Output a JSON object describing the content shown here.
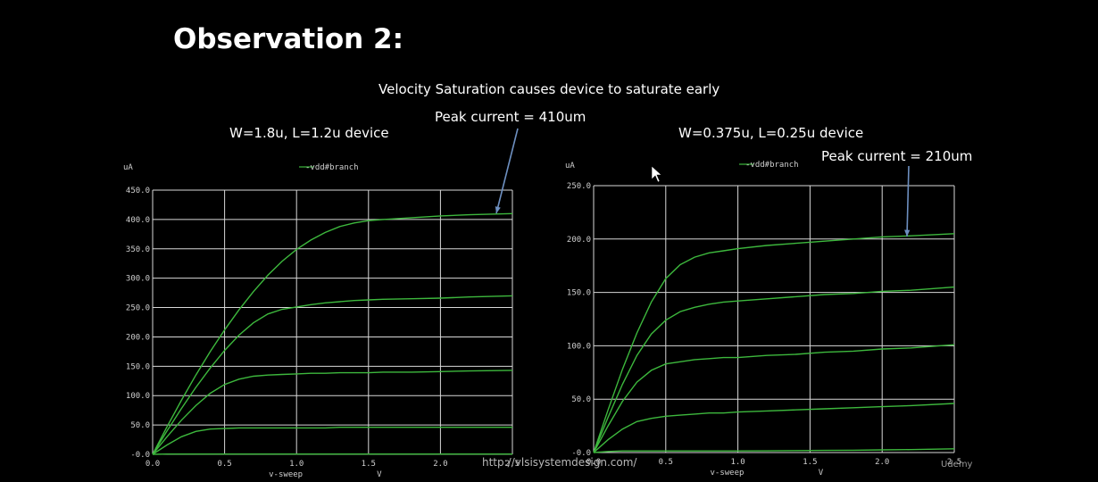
{
  "slide": {
    "title": "Observation 2:",
    "velocity_note": "Velocity Saturation causes device to saturate early",
    "watermark": "http://vlsisystemdesign.com/",
    "logo_text": "Udemy"
  },
  "colors": {
    "background": "#000000",
    "grid": "#d8d8d8",
    "curve": "#3db83d",
    "text": "#ffffff",
    "arrow": "#6d8fc0"
  },
  "chart_data": [
    {
      "type": "line",
      "device_label": "W=1.8u, L=1.2u device",
      "peak_annotation": "Peak current = 410um",
      "legend": "-vdd#branch",
      "legend_position": "top-center",
      "ylabel": "uA",
      "xlabel": "v-sweep",
      "xunit": "V",
      "xlim": [
        0,
        2.5
      ],
      "ylim": [
        0,
        450
      ],
      "xticks": [
        "0.0",
        "0.5",
        "1.0",
        "1.5",
        "2.0",
        "2.5"
      ],
      "yticks": [
        "-0.0",
        "50.0",
        "100.0",
        "150.0",
        "200.0",
        "250.0",
        "300.0",
        "350.0",
        "400.0",
        "450.0"
      ],
      "x": [
        0,
        0.1,
        0.2,
        0.3,
        0.4,
        0.5,
        0.6,
        0.7,
        0.8,
        0.9,
        1.0,
        1.1,
        1.2,
        1.3,
        1.4,
        1.5,
        1.6,
        1.8,
        2.0,
        2.2,
        2.5
      ],
      "series": [
        {
          "values": [
            0,
            47,
            92,
            135,
            175,
            212,
            246,
            277,
            305,
            329,
            349,
            365,
            378,
            388,
            394,
            398,
            400,
            403,
            406,
            408,
            410
          ]
        },
        {
          "values": [
            0,
            40,
            78,
            114,
            147,
            177,
            203,
            224,
            239,
            247,
            251,
            255,
            258,
            260,
            262,
            263,
            264,
            265,
            266,
            268,
            270
          ]
        },
        {
          "values": [
            0,
            30,
            58,
            83,
            104,
            119,
            128,
            133,
            135,
            136,
            137,
            138,
            138,
            139,
            139,
            139,
            140,
            140,
            141,
            142,
            143
          ]
        },
        {
          "values": [
            0,
            16,
            30,
            39,
            43,
            44,
            45,
            45,
            45,
            45,
            45,
            45,
            45,
            46,
            46,
            46,
            46,
            46,
            46,
            46,
            46
          ]
        },
        {
          "values": [
            0,
            0.5,
            0.5,
            0.5,
            0.5,
            0.5,
            0.5,
            0.5,
            0.5,
            0.5,
            0.5,
            0.5,
            0.5,
            0.5,
            0.5,
            0.5,
            0.5,
            0.5,
            0.5,
            0.5,
            0.5
          ]
        }
      ]
    },
    {
      "type": "line",
      "device_label": "W=0.375u, L=0.25u device",
      "peak_annotation": "Peak current = 210um",
      "legend": "-vdd#branch",
      "legend_position": "top-center",
      "ylabel": "uA",
      "xlabel": "v-sweep",
      "xunit": "V",
      "xlim": [
        0,
        2.5
      ],
      "ylim": [
        0,
        250
      ],
      "xticks": [
        "0.0",
        "0.5",
        "1.0",
        "1.5",
        "2.0",
        "2.5"
      ],
      "yticks": [
        "-0.0",
        "50.0",
        "100.0",
        "150.0",
        "200.0",
        "250.0"
      ],
      "x": [
        0,
        0.1,
        0.2,
        0.3,
        0.4,
        0.5,
        0.6,
        0.7,
        0.8,
        0.9,
        1.0,
        1.2,
        1.4,
        1.6,
        1.8,
        2.0,
        2.2,
        2.5
      ],
      "series": [
        {
          "values": [
            0,
            40,
            78,
            112,
            141,
            163,
            176,
            183,
            187,
            189,
            191,
            194,
            196,
            198,
            200,
            202,
            203,
            205
          ]
        },
        {
          "values": [
            0,
            33,
            64,
            91,
            111,
            124,
            132,
            136,
            139,
            141,
            142,
            144,
            146,
            148,
            149,
            151,
            152,
            155
          ]
        },
        {
          "values": [
            0,
            25,
            48,
            66,
            77,
            83,
            85,
            87,
            88,
            89,
            89,
            91,
            92,
            94,
            95,
            97,
            98,
            101
          ]
        },
        {
          "values": [
            0,
            12,
            22,
            29,
            32,
            34,
            35,
            36,
            37,
            37,
            38,
            39,
            40,
            41,
            42,
            43,
            44,
            46
          ]
        },
        {
          "values": [
            0,
            1,
            1.5,
            1.5,
            1.5,
            1.5,
            1.5,
            1.5,
            1.5,
            1.5,
            1.5,
            1.6,
            1.8,
            2,
            2.2,
            2.5,
            2.8,
            3.5
          ]
        }
      ]
    }
  ]
}
